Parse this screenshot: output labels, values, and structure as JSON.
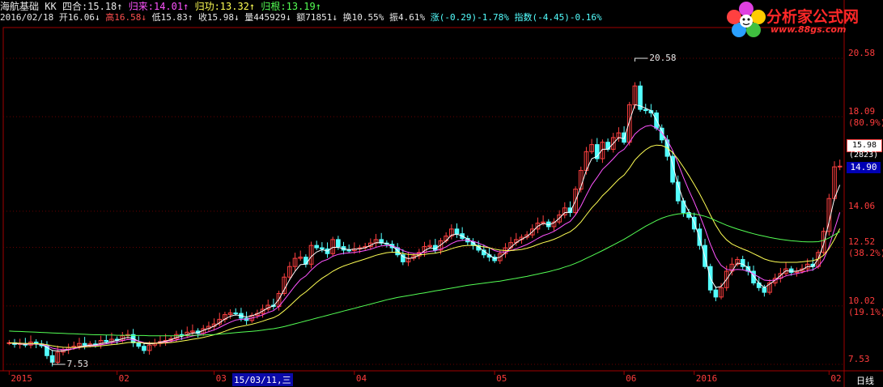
{
  "header": {
    "name": "海航基础",
    "indicator": "KK",
    "l1_items": [
      {
        "label": "四合:15.18",
        "arrow": "↑",
        "cls": "w"
      },
      {
        "label": "归来:14.01",
        "arrow": "↑",
        "cls": "m"
      },
      {
        "label": "归功:13.32",
        "arrow": "↑",
        "cls": "y"
      },
      {
        "label": "归根:13.19",
        "arrow": "↑",
        "cls": "g"
      }
    ],
    "date": "2016/02/18",
    "l2_items": [
      {
        "label": "开16.06",
        "arrow": "↓",
        "cls": "w"
      },
      {
        "label": "高16.58",
        "arrow": "↓",
        "cls": "r"
      },
      {
        "label": "低15.83",
        "arrow": "↑",
        "cls": "w"
      },
      {
        "label": "收15.98",
        "arrow": "↓",
        "cls": "w"
      },
      {
        "label": "量445929",
        "arrow": "↓",
        "cls": "w"
      },
      {
        "label": "额71851",
        "arrow": "↓",
        "cls": "w"
      },
      {
        "label": "换10.55%",
        "arrow": "",
        "cls": "w"
      },
      {
        "label": "振4.61%",
        "arrow": "",
        "cls": "w"
      },
      {
        "label": "涨(-0.29)-1.78%",
        "arrow": "",
        "cls": "c"
      },
      {
        "label": "指数(-4.45)-0.16%",
        "arrow": "",
        "cls": "c"
      }
    ]
  },
  "logo": {
    "main": "分析家公式网",
    "url": "www.88gs.com"
  },
  "right_axis": {
    "labels": [
      {
        "text": "20.58",
        "pos": 20.58,
        "dy": -7
      },
      {
        "text": "18.09",
        "pos": 18.09,
        "dy": -7
      },
      {
        "text": "(80.9%)",
        "pos": 18.09,
        "dy": 7
      },
      {
        "text": "14.06",
        "pos": 14.06,
        "dy": -7
      },
      {
        "text": "12.52",
        "pos": 12.52,
        "dy": -7
      },
      {
        "text": "(38.2%)",
        "pos": 12.52,
        "dy": 7
      },
      {
        "text": "10.02",
        "pos": 10.02,
        "dy": -7
      },
      {
        "text": "(19.1%)",
        "pos": 10.02,
        "dy": 7
      },
      {
        "text": "7.53",
        "pos": 7.53,
        "dy": -7
      }
    ],
    "current_price": "15.98",
    "count": "(2823)",
    "cursor_price": "14.90"
  },
  "x_axis": {
    "labels": [
      {
        "text": "2015",
        "i": 0
      },
      {
        "text": "02",
        "i": 20
      },
      {
        "text": "03",
        "i": 38
      },
      {
        "text": "04",
        "i": 64
      },
      {
        "text": "05",
        "i": 90
      },
      {
        "text": "06",
        "i": 114
      },
      {
        "text": "2016",
        "i": 127
      },
      {
        "text": "02",
        "i": 152
      }
    ],
    "highlight": "15/03/11,三",
    "period": "日线"
  },
  "chart_data": {
    "type": "line",
    "y_axis": {
      "min": 7.53,
      "max": 20.58
    },
    "annotations": [
      {
        "text": "20.58",
        "kind": "high"
      },
      {
        "text": "7.53",
        "kind": "low"
      }
    ],
    "candle_closes": [
      8.45,
      8.38,
      8.42,
      8.35,
      8.48,
      8.4,
      8.32,
      7.9,
      7.62,
      8.05,
      8.15,
      8.25,
      8.3,
      8.42,
      8.35,
      8.4,
      8.38,
      8.55,
      8.5,
      8.6,
      8.55,
      8.75,
      8.8,
      8.45,
      8.3,
      8.12,
      8.35,
      8.42,
      8.5,
      8.55,
      8.62,
      8.8,
      8.75,
      8.9,
      8.95,
      8.85,
      9.05,
      9.15,
      9.25,
      9.45,
      9.65,
      9.72,
      9.7,
      9.5,
      9.4,
      9.62,
      9.7,
      9.88,
      10.05,
      10.0,
      10.55,
      11.25,
      11.7,
      12.05,
      12.1,
      11.8,
      12.6,
      12.5,
      12.45,
      12.25,
      12.85,
      12.55,
      12.4,
      12.38,
      12.45,
      12.5,
      12.55,
      12.7,
      12.85,
      12.7,
      12.65,
      12.5,
      12.2,
      11.9,
      12.05,
      12.15,
      12.3,
      12.55,
      12.6,
      12.4,
      12.8,
      13.0,
      13.3,
      13.1,
      12.9,
      12.75,
      12.6,
      12.4,
      12.2,
      12.1,
      11.95,
      12.25,
      12.5,
      12.72,
      12.85,
      12.95,
      13.05,
      13.3,
      13.55,
      13.6,
      13.4,
      13.6,
      13.9,
      14.2,
      14.0,
      15.0,
      15.8,
      16.6,
      16.9,
      16.3,
      17.0,
      16.7,
      17.2,
      17.4,
      17.0,
      18.6,
      19.4,
      18.4,
      18.35,
      18.25,
      17.6,
      17.1,
      16.4,
      15.3,
      14.5,
      14.0,
      13.8,
      13.3,
      12.6,
      11.7,
      10.7,
      10.4,
      10.8,
      11.5,
      11.8,
      12.0,
      11.7,
      11.5,
      11.0,
      10.8,
      10.6,
      11.0,
      11.2,
      11.4,
      11.6,
      11.45,
      11.5,
      11.6,
      11.8,
      11.7,
      12.3,
      13.2,
      14.6,
      15.95,
      15.98
    ],
    "series": [
      {
        "name": "四合",
        "color": "#ffffff",
        "values": [
          8.45,
          8.42,
          8.4,
          8.38,
          8.4,
          8.39,
          8.38,
          8.25,
          8.12,
          8.1,
          8.1,
          8.15,
          8.2,
          8.28,
          8.32,
          8.35,
          8.36,
          8.42,
          8.45,
          8.5,
          8.55,
          8.62,
          8.68,
          8.62,
          8.52,
          8.42,
          8.4,
          8.42,
          8.48,
          8.52,
          8.58,
          8.68,
          8.72,
          8.8,
          8.86,
          8.88,
          8.98,
          9.06,
          9.16,
          9.3,
          9.46,
          9.58,
          9.64,
          9.6,
          9.55,
          9.6,
          9.68,
          9.8,
          9.94,
          10.02,
          10.3,
          10.72,
          11.14,
          11.5,
          11.78,
          11.8,
          12.12,
          12.32,
          12.42,
          12.36,
          12.52,
          12.52,
          12.46,
          12.42,
          12.44,
          12.46,
          12.5,
          12.6,
          12.72,
          12.72,
          12.68,
          12.58,
          12.38,
          12.12,
          12.04,
          12.08,
          12.18,
          12.38,
          12.5,
          12.46,
          12.62,
          12.8,
          13.04,
          13.08,
          13.0,
          12.88,
          12.72,
          12.54,
          12.36,
          12.2,
          12.04,
          12.1,
          12.28,
          12.52,
          12.72,
          12.86,
          12.98,
          13.18,
          13.42,
          13.54,
          13.48,
          13.56,
          13.76,
          14.0,
          14.02,
          14.5,
          15.1,
          15.8,
          16.3,
          16.4,
          16.7,
          16.7,
          16.95,
          17.2,
          17.15,
          17.9,
          18.6,
          18.55,
          18.45,
          18.35,
          17.95,
          17.5,
          16.9,
          16.05,
          15.2,
          14.5,
          14.05,
          13.6,
          12.9,
          12.1,
          11.2,
          10.8,
          10.85,
          11.15,
          11.5,
          11.85,
          11.8,
          11.65,
          11.3,
          11.0,
          10.8,
          10.95,
          11.12,
          11.32,
          11.52,
          11.5,
          11.5,
          11.56,
          11.7,
          11.7,
          12.02,
          12.66,
          13.6,
          14.6,
          15.18
        ]
      },
      {
        "name": "归来",
        "color": "#ff54ff",
        "values": [
          8.45,
          8.44,
          8.42,
          8.4,
          8.4,
          8.4,
          8.39,
          8.32,
          8.22,
          8.18,
          8.16,
          8.17,
          8.2,
          8.24,
          8.28,
          8.31,
          8.33,
          8.37,
          8.4,
          8.44,
          8.48,
          8.54,
          8.59,
          8.57,
          8.52,
          8.46,
          8.44,
          8.43,
          8.45,
          8.47,
          8.51,
          8.57,
          8.62,
          8.68,
          8.74,
          8.78,
          8.85,
          8.92,
          9.0,
          9.1,
          9.22,
          9.33,
          9.42,
          9.45,
          9.46,
          9.5,
          9.56,
          9.64,
          9.74,
          9.82,
          10.0,
          10.28,
          10.58,
          10.88,
          11.14,
          11.3,
          11.55,
          11.76,
          11.92,
          12.0,
          12.14,
          12.22,
          12.26,
          12.28,
          12.3,
          12.34,
          12.38,
          12.44,
          12.52,
          12.58,
          12.6,
          12.58,
          12.5,
          12.38,
          12.3,
          12.26,
          12.26,
          12.3,
          12.35,
          12.37,
          12.44,
          12.54,
          12.68,
          12.78,
          12.82,
          12.82,
          12.78,
          12.7,
          12.6,
          12.5,
          12.38,
          12.32,
          12.32,
          12.38,
          12.46,
          12.55,
          12.64,
          12.76,
          12.9,
          13.02,
          13.1,
          13.2,
          13.34,
          13.5,
          13.62,
          13.9,
          14.28,
          14.74,
          15.18,
          15.5,
          15.84,
          16.06,
          16.3,
          16.55,
          16.7,
          17.0,
          17.35,
          17.55,
          17.68,
          17.72,
          17.6,
          17.4,
          17.1,
          16.65,
          16.1,
          15.5,
          14.95,
          14.45,
          13.9,
          13.3,
          12.65,
          12.1,
          11.75,
          11.58,
          11.55,
          11.58,
          11.56,
          11.5,
          11.38,
          11.25,
          11.12,
          11.1,
          11.13,
          11.2,
          11.3,
          11.36,
          11.4,
          11.45,
          11.52,
          11.56,
          11.7,
          12.0,
          12.55,
          13.28,
          14.01
        ]
      },
      {
        "name": "归功",
        "color": "#ffff54",
        "values": [
          8.45,
          8.44,
          8.43,
          8.42,
          8.42,
          8.41,
          8.4,
          8.37,
          8.32,
          8.28,
          8.26,
          8.25,
          8.25,
          8.26,
          8.27,
          8.29,
          8.3,
          8.32,
          8.34,
          8.37,
          8.39,
          8.42,
          8.46,
          8.47,
          8.46,
          8.44,
          8.43,
          8.43,
          8.43,
          8.44,
          8.46,
          8.49,
          8.52,
          8.56,
          8.6,
          8.63,
          8.68,
          8.73,
          8.79,
          8.86,
          8.94,
          9.03,
          9.1,
          9.15,
          9.19,
          9.24,
          9.3,
          9.37,
          9.45,
          9.52,
          9.64,
          9.82,
          10.02,
          10.24,
          10.45,
          10.62,
          10.82,
          11.02,
          11.2,
          11.34,
          11.5,
          11.62,
          11.72,
          11.8,
          11.88,
          11.95,
          12.02,
          12.1,
          12.18,
          12.24,
          12.29,
          12.31,
          12.3,
          12.26,
          12.22,
          12.2,
          12.2,
          12.22,
          12.25,
          12.27,
          12.32,
          12.38,
          12.46,
          12.53,
          12.58,
          12.6,
          12.6,
          12.58,
          12.54,
          12.5,
          12.44,
          12.4,
          12.38,
          12.38,
          12.4,
          12.43,
          12.48,
          12.55,
          12.64,
          12.72,
          12.78,
          12.86,
          12.96,
          13.08,
          13.18,
          13.36,
          13.6,
          13.9,
          14.2,
          14.44,
          14.72,
          14.94,
          15.18,
          15.42,
          15.6,
          15.9,
          16.24,
          16.48,
          16.68,
          16.82,
          16.88,
          16.86,
          16.76,
          16.56,
          16.28,
          15.94,
          15.58,
          15.2,
          14.8,
          14.36,
          13.9,
          13.46,
          13.1,
          12.84,
          12.66,
          12.55,
          12.45,
          12.36,
          12.25,
          12.14,
          12.02,
          11.95,
          11.9,
          11.88,
          11.88,
          11.88,
          11.88,
          11.9,
          11.93,
          11.95,
          12.02,
          12.18,
          12.46,
          12.86,
          13.32
        ]
      },
      {
        "name": "归根",
        "color": "#54ff54",
        "values": [
          8.95,
          8.94,
          8.93,
          8.92,
          8.91,
          8.9,
          8.89,
          8.88,
          8.87,
          8.86,
          8.85,
          8.84,
          8.83,
          8.82,
          8.81,
          8.8,
          8.79,
          8.79,
          8.78,
          8.78,
          8.77,
          8.77,
          8.77,
          8.76,
          8.76,
          8.76,
          8.75,
          8.75,
          8.75,
          8.75,
          8.75,
          8.75,
          8.76,
          8.76,
          8.77,
          8.77,
          8.78,
          8.79,
          8.8,
          8.82,
          8.84,
          8.86,
          8.88,
          8.9,
          8.92,
          8.94,
          8.96,
          8.99,
          9.02,
          9.05,
          9.09,
          9.14,
          9.2,
          9.26,
          9.32,
          9.38,
          9.44,
          9.5,
          9.56,
          9.62,
          9.68,
          9.74,
          9.8,
          9.86,
          9.92,
          9.98,
          10.04,
          10.1,
          10.16,
          10.22,
          10.28,
          10.33,
          10.38,
          10.42,
          10.46,
          10.5,
          10.54,
          10.58,
          10.62,
          10.66,
          10.7,
          10.74,
          10.78,
          10.82,
          10.86,
          10.9,
          10.93,
          10.96,
          10.99,
          11.02,
          11.05,
          11.08,
          11.12,
          11.16,
          11.2,
          11.24,
          11.28,
          11.33,
          11.38,
          11.43,
          11.48,
          11.54,
          11.6,
          11.68,
          11.75,
          11.84,
          11.94,
          12.05,
          12.16,
          12.27,
          12.38,
          12.5,
          12.62,
          12.74,
          12.86,
          13.0,
          13.14,
          13.28,
          13.42,
          13.54,
          13.66,
          13.76,
          13.84,
          13.9,
          13.94,
          13.96,
          13.96,
          13.94,
          13.9,
          13.84,
          13.76,
          13.66,
          13.56,
          13.46,
          13.38,
          13.3,
          13.23,
          13.16,
          13.1,
          13.04,
          12.99,
          12.94,
          12.9,
          12.86,
          12.83,
          12.8,
          12.78,
          12.76,
          12.75,
          12.75,
          12.76,
          12.82,
          12.92,
          13.05,
          13.19
        ]
      }
    ]
  }
}
